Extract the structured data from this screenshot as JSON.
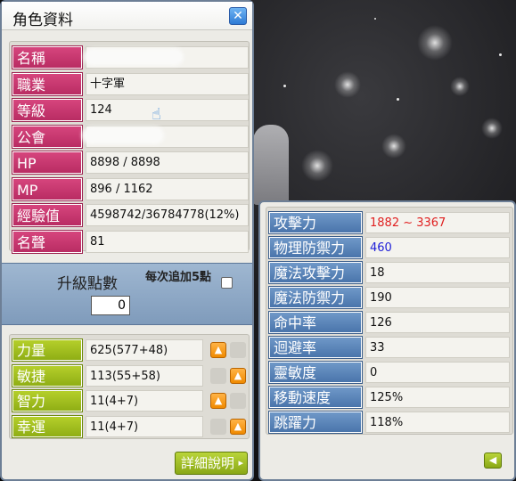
{
  "window": {
    "title": "角色資料"
  },
  "profile": [
    {
      "label": "名稱",
      "value": ""
    },
    {
      "label": "職業",
      "value": "十字軍"
    },
    {
      "label": "等級",
      "value": "124"
    },
    {
      "label": "公會",
      "value": ""
    },
    {
      "label": "HP",
      "value": "8898 / 8898"
    },
    {
      "label": "MP",
      "value": "896 / 1162"
    },
    {
      "label": "經驗值",
      "value": "4598742/36784778(12%)"
    },
    {
      "label": "名聲",
      "value": "81"
    }
  ],
  "level_up": {
    "label": "升級點數",
    "points": "0",
    "auto_label": "每次追加5點",
    "auto_checked": false
  },
  "stats": [
    {
      "label": "力量",
      "value": "625(577+48)"
    },
    {
      "label": "敏捷",
      "value": "113(55+58)"
    },
    {
      "label": "智力",
      "value": "11(4+7)"
    },
    {
      "label": "幸運",
      "value": "11(4+7)"
    }
  ],
  "detail_button": {
    "label": "詳細說明"
  },
  "details": [
    {
      "label": "攻擊力",
      "value": "1882 ~ 3367",
      "color": "#e02020"
    },
    {
      "label": "物理防禦力",
      "value": "460",
      "color": "#2020d8"
    },
    {
      "label": "魔法攻擊力",
      "value": "18",
      "color": "#111111"
    },
    {
      "label": "魔法防禦力",
      "value": "190",
      "color": "#111111"
    },
    {
      "label": "命中率",
      "value": "126",
      "color": "#111111"
    },
    {
      "label": "迴避率",
      "value": "33",
      "color": "#111111"
    },
    {
      "label": "靈敏度",
      "value": "0",
      "color": "#111111"
    },
    {
      "label": "移動速度",
      "value": "125%",
      "color": "#111111"
    },
    {
      "label": "跳躍力",
      "value": "118%",
      "color": "#111111"
    }
  ],
  "icons": {
    "close": "close-icon",
    "up": "arrow-up-icon",
    "back": "back-arrow-icon",
    "cursor": "hand-cursor-icon"
  }
}
